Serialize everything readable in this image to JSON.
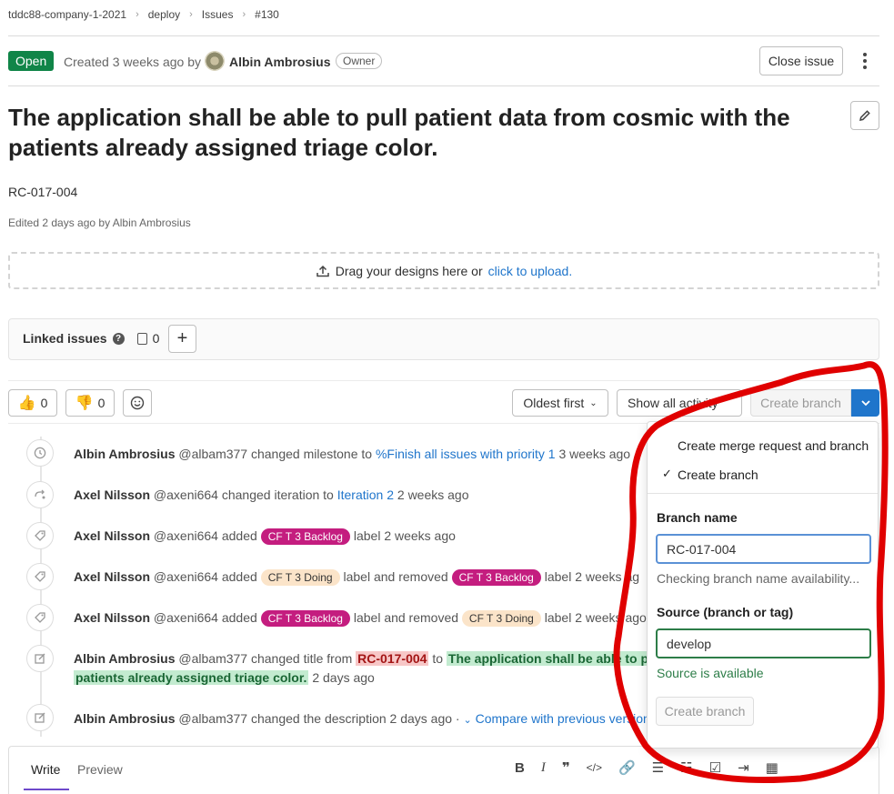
{
  "breadcrumb": {
    "items": [
      "tddc88-company-1-2021",
      "deploy",
      "Issues",
      "#130"
    ]
  },
  "issue_header": {
    "status": "Open",
    "created_prefix": "Created 3 weeks ago by",
    "author": "Albin Ambrosius",
    "role_badge": "Owner",
    "close_button": "Close issue"
  },
  "issue": {
    "title": "The application shall be able to pull patient data from cosmic with the patients already assigned triage color.",
    "description": "RC-017-004",
    "edited": "Edited 2 days ago by Albin Ambrosius"
  },
  "upload": {
    "text": "Drag your designs here or",
    "link": "click to upload."
  },
  "linked_issues": {
    "label": "Linked issues",
    "count": "0"
  },
  "awards": {
    "thumbs_up": "0",
    "thumbs_down": "0"
  },
  "activity_controls": {
    "sort": "Oldest first",
    "filter": "Show all activity",
    "create_branch": "Create branch"
  },
  "timeline": [
    {
      "author": "Albin Ambrosius",
      "handle": "@albam377",
      "text": "changed milestone to",
      "link": "%Finish all issues with priority 1",
      "time": "3 weeks ago"
    },
    {
      "author": "Axel Nilsson",
      "handle": "@axeni664",
      "text": "changed iteration to",
      "link": "Iteration 2",
      "time": "2 weeks ago"
    },
    {
      "author": "Axel Nilsson",
      "handle": "@axeni664",
      "text": "added",
      "label1": "CF T 3 Backlog",
      "text2": "label 2 weeks ago"
    },
    {
      "author": "Axel Nilsson",
      "handle": "@axeni664",
      "text": "added",
      "label1": "CF T 3 Doing",
      "text2": "label and removed",
      "label2": "CF T 3 Backlog",
      "text3": "label 2 weeks ag"
    },
    {
      "author": "Axel Nilsson",
      "handle": "@axeni664",
      "text": "added",
      "label1": "CF T 3 Backlog",
      "text2": "label and removed",
      "label2": "CF T 3 Doing",
      "text3": "label 2 weeks ago"
    },
    {
      "author": "Albin Ambrosius",
      "handle": "@albam377",
      "text": "changed title from",
      "old": "RC-017-004",
      "to": "to",
      "new_line1": "The application shall be able to pul",
      "new_line2": "patients already assigned triage color.",
      "time": "2 days ago"
    },
    {
      "author": "Albin Ambrosius",
      "handle": "@albam377",
      "text": "changed the description 2 days ago ·",
      "link": "Compare with previous version"
    }
  ],
  "editor": {
    "tab_write": "Write",
    "tab_preview": "Preview"
  },
  "branch_dropdown": {
    "option_mr": "Create merge request and branch",
    "option_branch": "Create branch",
    "branch_name_label": "Branch name",
    "branch_name_value": "RC-017-004",
    "branch_status": "Checking branch name availability...",
    "source_label": "Source (branch or tag)",
    "source_value": "develop",
    "source_status": "Source is available",
    "submit": "Create branch"
  },
  "colors": {
    "open_badge": "#108548",
    "link": "#1f75cb",
    "annotation": "#e00000",
    "label_backlog": "#c41d7f",
    "label_doing": "#fbe4c9"
  }
}
